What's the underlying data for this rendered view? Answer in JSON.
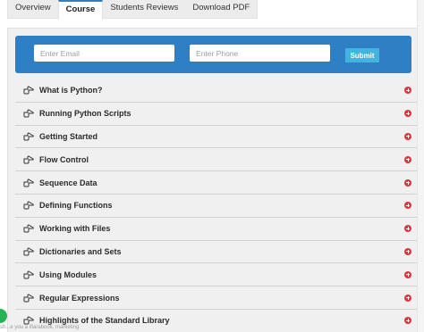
{
  "tabs": [
    {
      "label": "Overview",
      "active": false
    },
    {
      "label": "Course",
      "active": true
    },
    {
      "label": "Students Reviews",
      "active": false
    },
    {
      "label": "Download PDF",
      "active": false
    }
  ],
  "form": {
    "email_placeholder": "Enter Email",
    "phone_placeholder": "Enter Phone",
    "submit_label": "Submit"
  },
  "accordion": [
    "What is Python?",
    "Running Python Scripts",
    "Getting Started",
    "Flow Control",
    "Sequence Data",
    "Defining Functions",
    "Working with Files",
    "Dictionaries and Sets",
    "Using Modules",
    "Regular Expressions",
    "Highlights of the Standard Library"
  ],
  "icons": {
    "item_icon": "hand-pointing-right-icon",
    "expand_icon": "plus-circle-icon"
  },
  "colors": {
    "form_bar": "#2f7fc4",
    "submit": "#43b3e0",
    "expand": "#e0353f",
    "whatsapp": "#25b252"
  },
  "toast_text": "sh...e you a ifiarabook, marketing"
}
